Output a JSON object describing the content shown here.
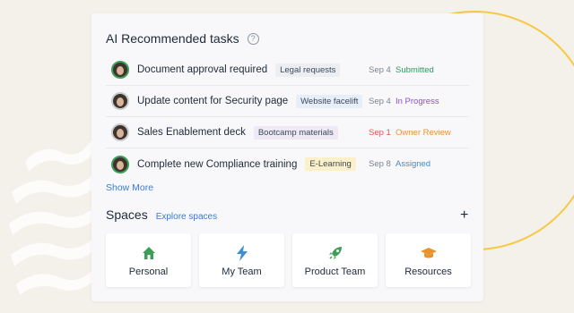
{
  "card": {
    "title": "AI Recommended tasks",
    "help_icon": "?"
  },
  "tasks": [
    {
      "name": "Document approval required",
      "tag": "Legal requests",
      "tag_color": "gray",
      "date": "Sep 4",
      "date_overdue": false,
      "status": "Submitted",
      "status_color": "#2e9a5e",
      "avatar": "green"
    },
    {
      "name": "Update content for Security page",
      "tag": "Website facelift",
      "tag_color": "blue",
      "date": "Sep 4",
      "date_overdue": false,
      "status": "In Progress",
      "status_color": "#8a4fd1",
      "avatar": "plain"
    },
    {
      "name": "Sales Enablement deck",
      "tag": "Bootcamp materials",
      "tag_color": "purple",
      "date": "Sep 1",
      "date_overdue": true,
      "status": "Owner Review",
      "status_color": "#e8932c",
      "avatar": "plain"
    },
    {
      "name": "Complete new Compliance training",
      "tag": "E-Learning",
      "tag_color": "yellow",
      "date": "Sep 8",
      "date_overdue": false,
      "status": "Assigned",
      "status_color": "#3b8fd4",
      "avatar": "green"
    }
  ],
  "show_more": "Show More",
  "spaces": {
    "title": "Spaces",
    "explore": "Explore spaces",
    "add_icon": "+",
    "items": [
      {
        "label": "Personal",
        "icon": "house-icon",
        "color": "#3f9d5a"
      },
      {
        "label": "My Team",
        "icon": "lightning-icon",
        "color": "#3b8fd4"
      },
      {
        "label": "Product Team",
        "icon": "rocket-icon",
        "color": "#3f9d5a"
      },
      {
        "label": "Resources",
        "icon": "graduation-cap-icon",
        "color": "#e8932c"
      }
    ]
  }
}
